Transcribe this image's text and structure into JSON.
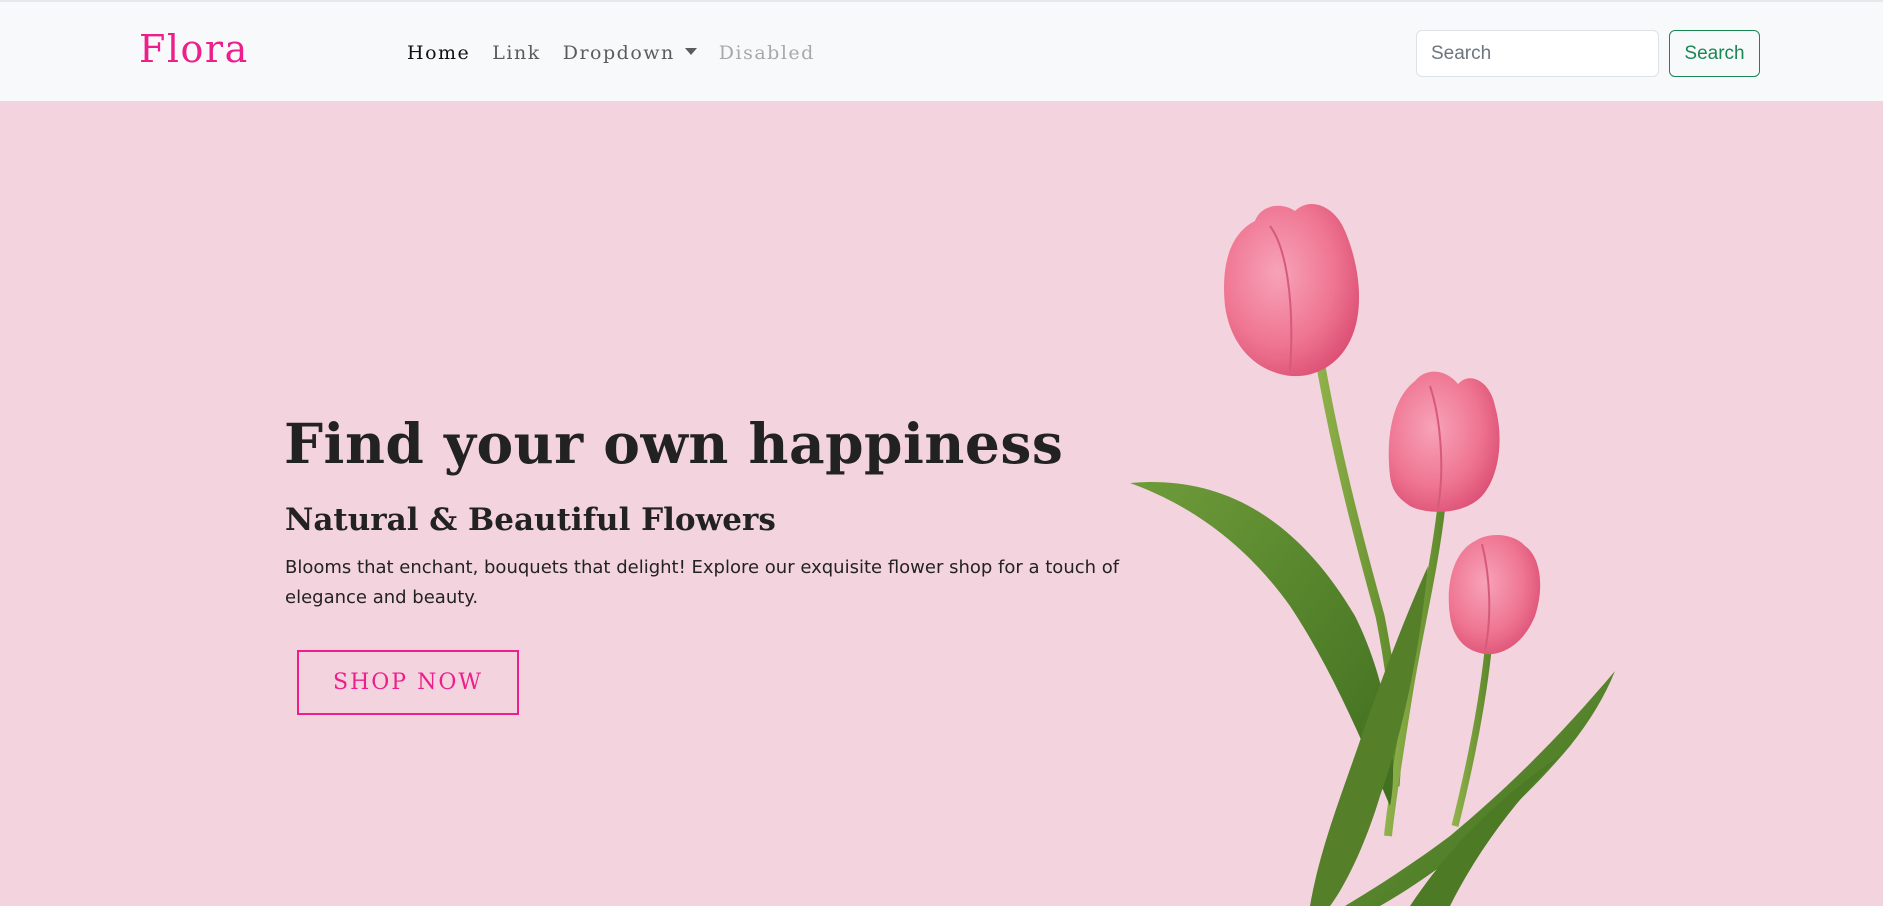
{
  "navbar": {
    "brand": "Flora",
    "links": [
      {
        "label": "Home",
        "state": "active"
      },
      {
        "label": "Link",
        "state": "default"
      },
      {
        "label": "Dropdown",
        "state": "dropdown"
      },
      {
        "label": "Disabled",
        "state": "disabled"
      }
    ],
    "search": {
      "placeholder": "Search",
      "value": "",
      "button_label": "Search"
    }
  },
  "hero": {
    "title": "Find your own happiness",
    "subtitle": "Natural & Beautiful Flowers",
    "description": "Blooms that enchant, bouquets that delight! Explore our exquisite flower shop for a touch of elegance and beauty.",
    "cta_label": "SHOP NOW",
    "image_icon": "tulips-image"
  },
  "colors": {
    "brand_pink": "#ec1f8c",
    "hero_background": "#f3d4de",
    "navbar_background": "#f8f9fb",
    "search_button_green": "#198754"
  }
}
